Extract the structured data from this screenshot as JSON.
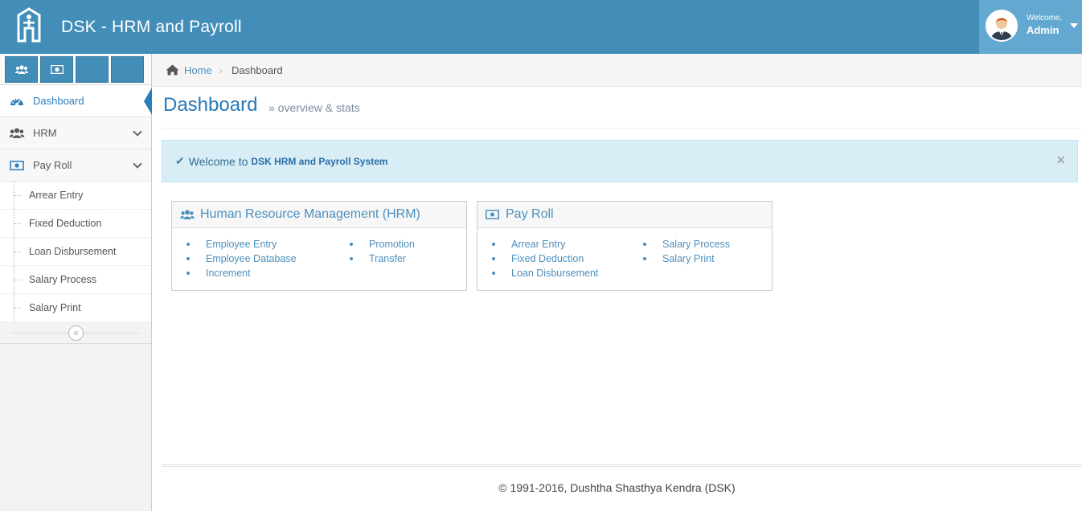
{
  "header": {
    "app_title": "DSK - HRM and Payroll",
    "welcome_label": "Welcome,",
    "user_name": "Admin",
    "colors": {
      "bar": "#438eb9",
      "user_box": "#62a8d1"
    }
  },
  "sidebar": {
    "shortcuts": [
      {
        "icon": "users-icon"
      },
      {
        "icon": "money-icon"
      },
      {
        "icon": ""
      },
      {
        "icon": ""
      }
    ],
    "items": [
      {
        "label": "Dashboard",
        "icon": "tachometer-icon",
        "active": true
      },
      {
        "label": "HRM",
        "icon": "users-icon"
      },
      {
        "label": "Pay Roll",
        "icon": "money-icon"
      }
    ],
    "payroll_sub": [
      "Arrear Entry",
      "Fixed Deduction",
      "Loan Disbursement",
      "Salary Process",
      "Salary Print"
    ],
    "collapse_icon": "double-angle-left-icon"
  },
  "breadcrumb": {
    "home": "Home",
    "current": "Dashboard"
  },
  "page_header": {
    "title": "Dashboard",
    "subtitle": "» overview & stats"
  },
  "alert": {
    "text": "Welcome to",
    "strong": "DSK HRM and Payroll System",
    "close": "×"
  },
  "widgets": {
    "hrm": {
      "title": "Human Resource Management (HRM)",
      "col1": [
        "Employee Entry",
        "Employee Database",
        "Increment"
      ],
      "col2": [
        "Promotion",
        "Transfer"
      ]
    },
    "payroll": {
      "title": "Pay Roll",
      "col1": [
        "Arrear Entry",
        "Fixed Deduction",
        "Loan Disbursement"
      ],
      "col2": [
        "Salary Process",
        "Salary Print"
      ]
    }
  },
  "footer": {
    "text": "© 1991-2016, Dushtha Shasthya Kendra (DSK)"
  }
}
